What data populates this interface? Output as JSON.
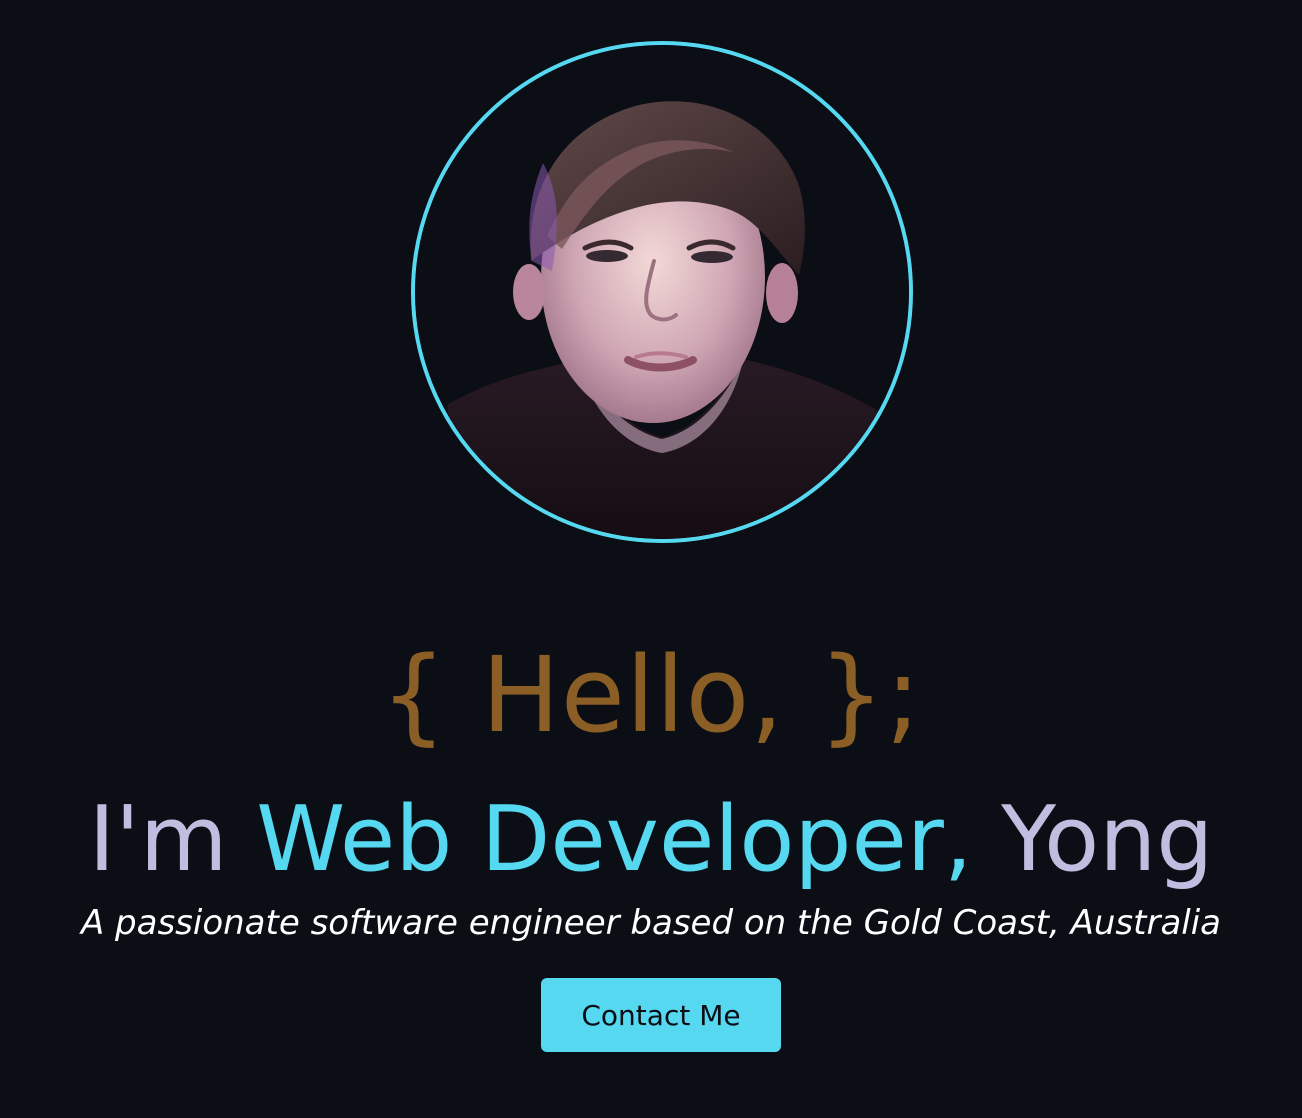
{
  "hero": {
    "greeting": "{ Hello, };",
    "headline": {
      "prefix": "I'm ",
      "role": "Web Developer,",
      "name": " Yong"
    },
    "tagline": "A passionate software engineer based on the Gold Coast, Australia",
    "contact_label": "Contact Me"
  },
  "colors": {
    "background": "#0b0e15",
    "accent": "#55d8f0",
    "greeting": "#8a5e25",
    "muted_text": "#c1bde0",
    "tagline": "#ffffff"
  }
}
